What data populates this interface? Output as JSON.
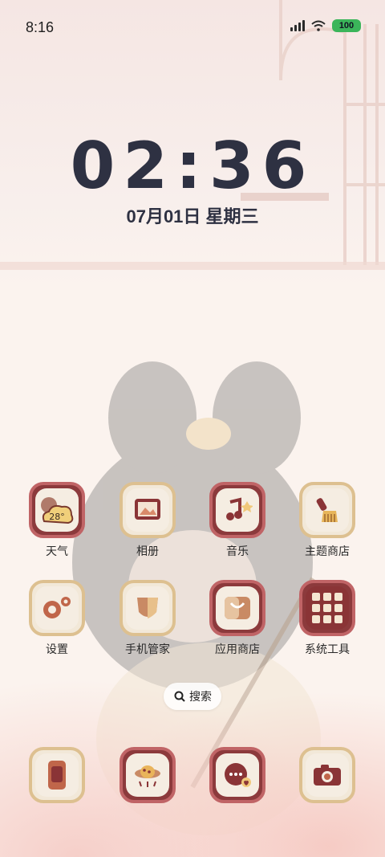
{
  "status_bar": {
    "time": "8:16",
    "battery": "100"
  },
  "clock": {
    "time": "02:36",
    "date": "07月01日 星期三"
  },
  "apps": [
    {
      "label": "天气",
      "icon": "weather-icon",
      "badge_text": "28°"
    },
    {
      "label": "相册",
      "icon": "gallery-icon"
    },
    {
      "label": "音乐",
      "icon": "music-icon"
    },
    {
      "label": "主题商店",
      "icon": "theme-store-icon"
    },
    {
      "label": "设置",
      "icon": "settings-icon"
    },
    {
      "label": "手机管家",
      "icon": "phone-manager-icon"
    },
    {
      "label": "应用商店",
      "icon": "app-store-icon"
    },
    {
      "label": "系统工具",
      "icon": "system-tools-icon"
    }
  ],
  "search": {
    "label": "搜索"
  },
  "dock": [
    {
      "icon": "phone-icon"
    },
    {
      "icon": "browser-icon"
    },
    {
      "icon": "messages-icon"
    },
    {
      "icon": "camera-icon"
    }
  ]
}
